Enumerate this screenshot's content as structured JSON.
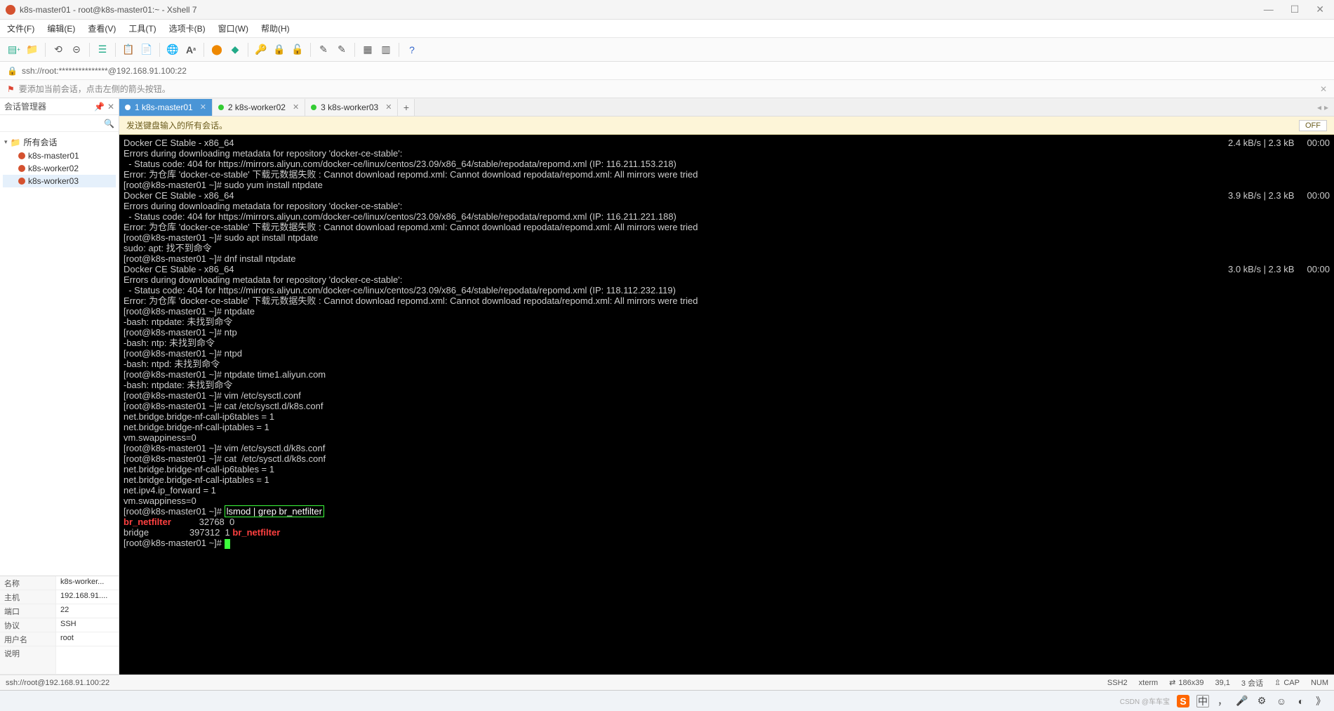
{
  "window": {
    "title": "k8s-master01 - root@k8s-master01:~ - Xshell 7"
  },
  "menu": [
    "文件(F)",
    "编辑(E)",
    "查看(V)",
    "工具(T)",
    "选项卡(B)",
    "窗口(W)",
    "帮助(H)"
  ],
  "addressbar": {
    "value": "ssh://root:***************@192.168.91.100:22"
  },
  "hint": "要添加当前会话，点击左侧的箭头按钮。",
  "sidebar": {
    "title": "会话管理器",
    "root": "所有会话",
    "items": [
      "k8s-master01",
      "k8s-worker02",
      "k8s-worker03"
    ]
  },
  "props": [
    {
      "k": "名称",
      "v": "k8s-worker..."
    },
    {
      "k": "主机",
      "v": "192.168.91...."
    },
    {
      "k": "端口",
      "v": "22"
    },
    {
      "k": "协议",
      "v": "SSH"
    },
    {
      "k": "用户名",
      "v": "root"
    },
    {
      "k": "说明",
      "v": ""
    }
  ],
  "tabs": [
    {
      "label": "1 k8s-master01",
      "active": true
    },
    {
      "label": "2 k8s-worker02",
      "active": false
    },
    {
      "label": "3 k8s-worker03",
      "active": false
    }
  ],
  "broadcast": {
    "text": "发送键盘输入的所有会话。",
    "toggle": "OFF"
  },
  "terminal": {
    "lines": [
      {
        "l": "Docker CE Stable - x86_64",
        "r": "2.4 kB/s | 2.3 kB     00:00"
      },
      {
        "l": "Errors during downloading metadata for repository 'docker-ce-stable':"
      },
      {
        "l": "  - Status code: 404 for https://mirrors.aliyun.com/docker-ce/linux/centos/23.09/x86_64/stable/repodata/repomd.xml (IP: 116.211.153.218)"
      },
      {
        "l": "Error: 为仓库 'docker-ce-stable' 下载元数据失败 : Cannot download repomd.xml: Cannot download repodata/repomd.xml: All mirrors were tried"
      },
      {
        "l": "[root@k8s-master01 ~]# sudo yum install ntpdate"
      },
      {
        "l": "Docker CE Stable - x86_64",
        "r": "3.9 kB/s | 2.3 kB     00:00"
      },
      {
        "l": "Errors during downloading metadata for repository 'docker-ce-stable':"
      },
      {
        "l": "  - Status code: 404 for https://mirrors.aliyun.com/docker-ce/linux/centos/23.09/x86_64/stable/repodata/repomd.xml (IP: 116.211.221.188)"
      },
      {
        "l": "Error: 为仓库 'docker-ce-stable' 下载元数据失败 : Cannot download repomd.xml: Cannot download repodata/repomd.xml: All mirrors were tried"
      },
      {
        "l": "[root@k8s-master01 ~]# sudo apt install ntpdate"
      },
      {
        "l": "sudo: apt: 找不到命令"
      },
      {
        "l": "[root@k8s-master01 ~]# dnf install ntpdate"
      },
      {
        "l": "Docker CE Stable - x86_64",
        "r": "3.0 kB/s | 2.3 kB     00:00"
      },
      {
        "l": "Errors during downloading metadata for repository 'docker-ce-stable':"
      },
      {
        "l": "  - Status code: 404 for https://mirrors.aliyun.com/docker-ce/linux/centos/23.09/x86_64/stable/repodata/repomd.xml (IP: 118.112.232.119)"
      },
      {
        "l": "Error: 为仓库 'docker-ce-stable' 下载元数据失败 : Cannot download repomd.xml: Cannot download repodata/repomd.xml: All mirrors were tried"
      },
      {
        "l": "[root@k8s-master01 ~]# ntpdate"
      },
      {
        "l": "-bash: ntpdate: 未找到命令"
      },
      {
        "l": "[root@k8s-master01 ~]# ntp"
      },
      {
        "l": "-bash: ntp: 未找到命令"
      },
      {
        "l": "[root@k8s-master01 ~]# ntpd"
      },
      {
        "l": "-bash: ntpd: 未找到命令"
      },
      {
        "l": "[root@k8s-master01 ~]# ntpdate time1.aliyun.com"
      },
      {
        "l": "-bash: ntpdate: 未找到命令"
      },
      {
        "l": "[root@k8s-master01 ~]# vim /etc/sysctl.conf"
      },
      {
        "l": "[root@k8s-master01 ~]# cat /etc/sysctl.d/k8s.conf"
      },
      {
        "l": "net.bridge.bridge-nf-call-ip6tables = 1"
      },
      {
        "l": "net.bridge.bridge-nf-call-iptables = 1"
      },
      {
        "l": "vm.swappiness=0"
      },
      {
        "l": "[root@k8s-master01 ~]# vim /etc/sysctl.d/k8s.conf"
      },
      {
        "l": "[root@k8s-master01 ~]# cat  /etc/sysctl.d/k8s.conf"
      },
      {
        "l": "net.bridge.bridge-nf-call-ip6tables = 1"
      },
      {
        "l": "net.bridge.bridge-nf-call-iptables = 1"
      },
      {
        "l": "net.ipv4.ip_forward = 1"
      },
      {
        "l": "vm.swappiness=0"
      }
    ],
    "boxed_prompt": "[root@k8s-master01 ~]# ",
    "boxed_cmd": "lsmod | grep br_netfilter",
    "out1_a": "br_netfilter",
    "out1_b": "           32768  0",
    "out2_a": "bridge                397312  1 ",
    "out2_b": "br_netfilter",
    "final_prompt": "[root@k8s-master01 ~]# "
  },
  "status": {
    "left": "ssh://root@192.168.91.100:22",
    "ssh": "SSH2",
    "term": "xterm",
    "size": "186x39",
    "rows": "39,1",
    "sess": "3 会话"
  },
  "taskbar": {
    "ime": "中",
    "watermark": "CSDN @车车宝"
  }
}
